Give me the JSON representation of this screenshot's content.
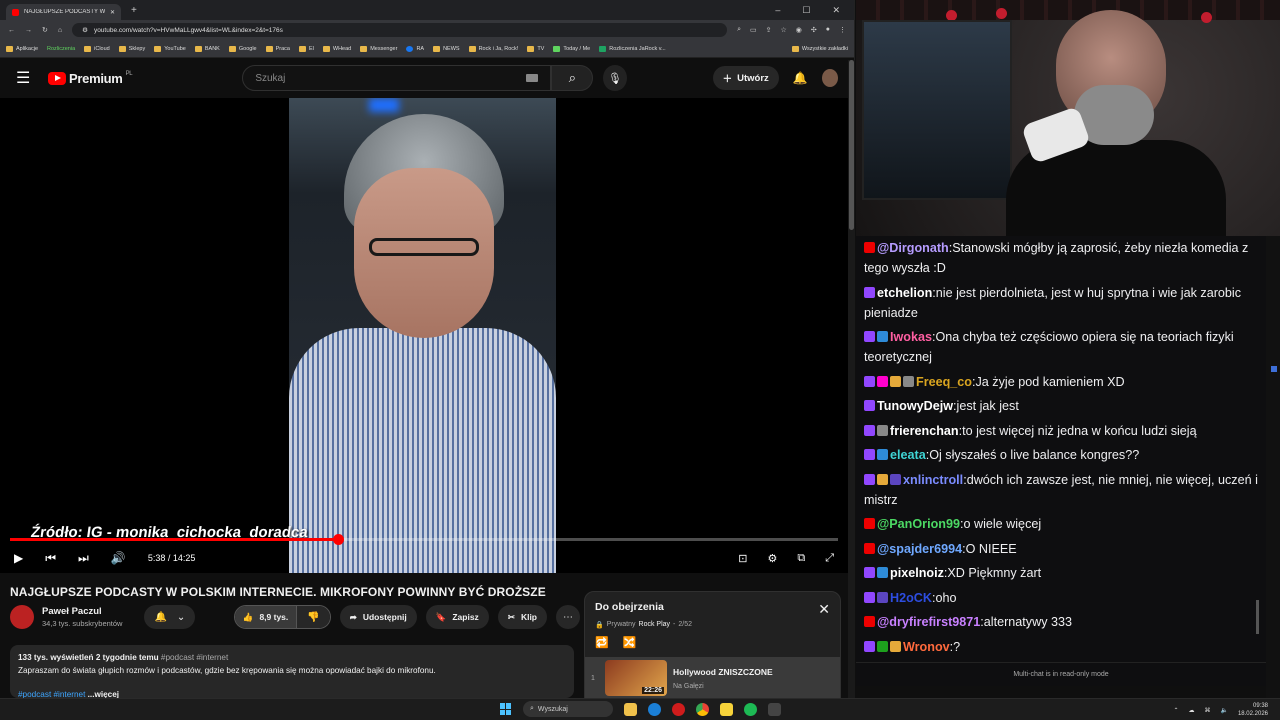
{
  "browser": {
    "tab_title": "NAJGŁUPSZE PODCASTY W PO",
    "url": "youtube.com/watch?v=HVwMaLLgwv4&list=WL&index=2&t=176s",
    "bookmarks": [
      "Aplikacje",
      "Rozliczenia",
      "iCloud",
      "Sklepy",
      "YouTube",
      "BANK",
      "Google",
      "Praca",
      "El",
      "WHead",
      "Messenger",
      "RA",
      "NEWS",
      "Rock i Ja, Rock!",
      "TV",
      "Today / Me",
      "Rozliczenia JaRock v...",
      "Wszystkie zakładki"
    ]
  },
  "yt": {
    "logo": "Premium",
    "logo_region": "PL",
    "search_placeholder": "Szukaj",
    "create_label": "Utwórz"
  },
  "video": {
    "source_overlay": "Źródło: IG - monika_cichocka_doradca",
    "time": "5:38 / 14:25",
    "progress": 0.396
  },
  "meta": {
    "title": "NAJGŁUPSZE PODCASTY W POLSKIM INTERNECIE. MIKROFONY POWINNY BYĆ DROŻSZE",
    "channel": "Paweł Paczul",
    "subs": "34,3 tys. subskrybentów",
    "likes": "8,9 tys.",
    "share": "Udostępnij",
    "save": "Zapisz",
    "clip": "Klip",
    "desc_stats": "133 tys. wyświetleń  2 tygodnie temu",
    "desc_stats_tags": "#podcast #internet",
    "desc_text": "Zapraszam do świata głupich rozmów i podcastów, gdzie bez krępowania się można opowiadać bajki do mikrofonu.",
    "desc_tags": "#podcast #internet",
    "more": "...więcej"
  },
  "playlist": {
    "title": "Do obejrzenia",
    "privacy": "Prywatny",
    "owner": "Rock Play",
    "position": "2/52",
    "item_num": "1",
    "item_title": "Hollywood ZNISZCZONE",
    "item_channel": "Na Gałęzi",
    "item_duration": "22:26"
  },
  "chat": [
    {
      "badges": [
        "yt"
      ],
      "user": "@Dirgonath",
      "color": "#b69cff",
      "text": "Stanowski mógłby ją zaprosić, żeby niezła komedia z tego wyszła :D"
    },
    {
      "badges": [
        "tw"
      ],
      "user": "etchelion",
      "color": "#ffffff",
      "text": "nie jest pierdolnieta, jest w huj sprytna i wie jak zarobic pieniadze"
    },
    {
      "badges": [
        "tw",
        "sub"
      ],
      "user": "Iwokas",
      "color": "#ff5fa2",
      "text": "Ona chyba też częściowo opiera się na teoriach fizyki teoretycznej"
    },
    {
      "badges": [
        "tw",
        "emo",
        "star",
        "g"
      ],
      "user": "Freeq_co",
      "color": "#daa520",
      "text": "Ja żyje pod kamieniem XD"
    },
    {
      "badges": [
        "tw"
      ],
      "user": "TunowyDejw",
      "color": "#ffffff",
      "text": "jest jak jest"
    },
    {
      "badges": [
        "tw",
        "g"
      ],
      "user": "frierenchan",
      "color": "#ffffff",
      "text": "to jest więcej niż jedna w końcu ludzi sieją"
    },
    {
      "badges": [
        "tw",
        "sub"
      ],
      "user": "eleata",
      "color": "#3fd4d4",
      "text": "Oj słyszałeś o live balance kongres??"
    },
    {
      "badges": [
        "tw",
        "star",
        "car"
      ],
      "user": "xnlinctroll",
      "color": "#7b8cff",
      "text": "dwóch ich zawsze jest, nie mniej, nie więcej, uczeń i mistrz"
    },
    {
      "badges": [
        "yt"
      ],
      "user": "@PanOrion99",
      "color": "#4cd964",
      "text": "o wiele więcej"
    },
    {
      "badges": [
        "yt"
      ],
      "user": "@spajder6994",
      "color": "#6fa8ff",
      "text": "O NIEEE"
    },
    {
      "badges": [
        "tw",
        "sub"
      ],
      "user": "pixelnoiz",
      "color": "#ffffff",
      "text": "XD Piękmny żart"
    },
    {
      "badges": [
        "tw",
        "car"
      ],
      "user": "H2oCK",
      "color": "#2d4de0",
      "text": "oho"
    },
    {
      "badges": [
        "yt"
      ],
      "user": "@dryfirefirst9871",
      "color": "#c880ff",
      "text": "alternatywy 333"
    },
    {
      "badges": [
        "tw",
        "chk",
        "star"
      ],
      "user": "Wronov",
      "color": "#ff6a3d",
      "text": "?"
    }
  ],
  "chat_footer": "Multi-chat is in read-only mode",
  "taskbar": {
    "search": "Wyszukaj",
    "time": "09:38",
    "date": "18.02.2026"
  }
}
